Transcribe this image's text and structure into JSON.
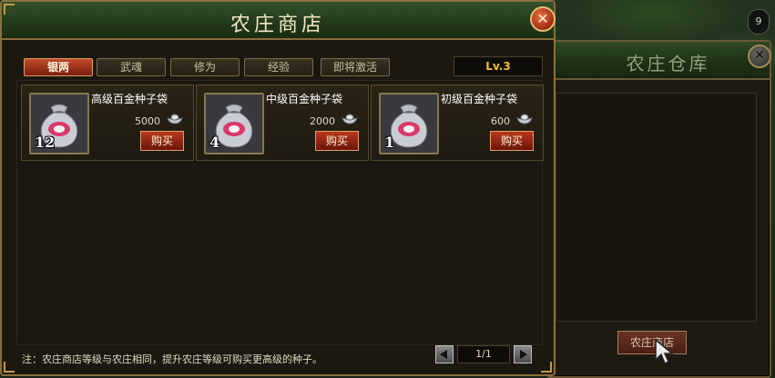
{
  "corner_counter": "9",
  "shop": {
    "title": "农庄商店",
    "close_glyph": "✕",
    "tabs": [
      {
        "label": "银两",
        "active": true
      },
      {
        "label": "武魂",
        "active": false
      },
      {
        "label": "修为",
        "active": false
      },
      {
        "label": "经验",
        "active": false
      },
      {
        "label": "即将激活",
        "active": false
      }
    ],
    "level": "Lv.3",
    "items": [
      {
        "name": "高级百金种子袋",
        "price": "5000",
        "count": "12",
        "buy_label": "购买"
      },
      {
        "name": "中级百金种子袋",
        "price": "2000",
        "count": "4",
        "buy_label": "购买"
      },
      {
        "name": "初级百金种子袋",
        "price": "600",
        "count": "1",
        "buy_label": "购买"
      }
    ],
    "note": "注：农庄商店等级与农庄相同，提升农庄等级可购买更高级的种子。",
    "pager": {
      "text": "1/1"
    }
  },
  "warehouse": {
    "title": "农庄仓库",
    "close_glyph": "✕",
    "shop_button_label": "农庄商店"
  },
  "colors": {
    "active_tab": "#c04a2a",
    "level_text": "#f0c030",
    "buy_button": "#b83820",
    "frame_gold": "#8a6e3a"
  },
  "icons": {
    "item": "seed-bag-icon",
    "currency": "silver-ingot-icon",
    "close": "close-icon"
  }
}
